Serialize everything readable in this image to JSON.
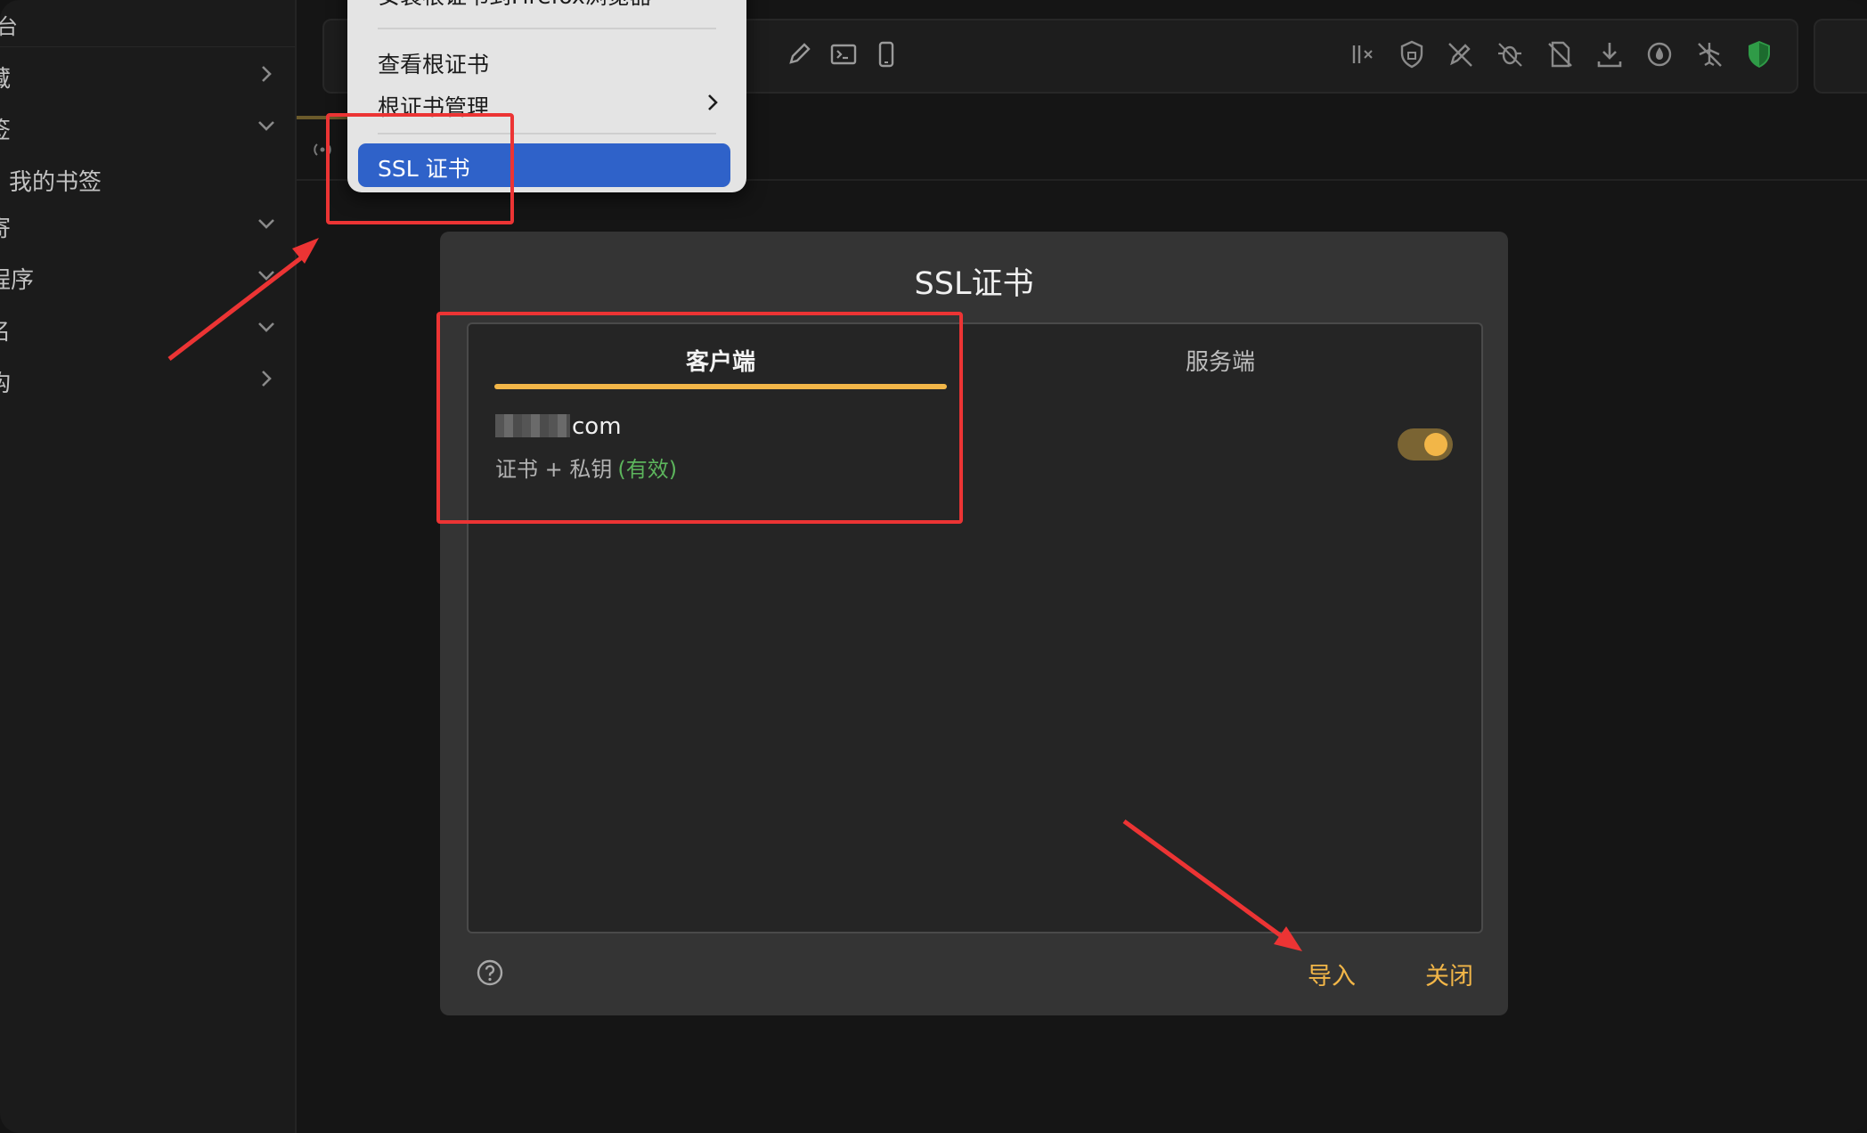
{
  "sidebar": {
    "top_label": "台",
    "items": [
      {
        "label": "藏",
        "chevron": "chevron-right-icon"
      },
      {
        "label": "签",
        "chevron": "chevron-down-icon"
      },
      {
        "label": "我的书签",
        "chevron": ""
      },
      {
        "label": "寄",
        "chevron": "chevron-down-icon"
      },
      {
        "label": "程序",
        "chevron": "chevron-down-icon"
      },
      {
        "label": "名",
        "chevron": "chevron-down-icon"
      },
      {
        "label": "构",
        "chevron": "chevron-right-icon"
      }
    ]
  },
  "toolbar": {
    "icons": [
      "edit-icon",
      "terminal-icon",
      "phone-icon",
      "split-icon",
      "shield-lock-icon",
      "pen-off-icon",
      "bug-off-icon",
      "file-off-icon",
      "download-icon",
      "drop-icon",
      "plane-off-icon",
      "shield-check-icon"
    ]
  },
  "context_menu": {
    "item_firefox": "安装根证书到Firefox浏览器",
    "item_view_root": "查看根证书",
    "item_manage_root": "根证书管理",
    "item_ssl": "SSL 证书"
  },
  "dialog": {
    "title": "SSL证书",
    "tab_client": "客户端",
    "tab_server": "服务端",
    "cert": {
      "domain_suffix": "com",
      "type": "证书 + 私钥",
      "status": "(有效)",
      "enabled": true
    },
    "import_label": "导入",
    "close_label": "关闭"
  },
  "colors": {
    "accent": "#f2b648",
    "selection": "#2f62c9",
    "valid": "#5cb45c",
    "annotation": "#ec3434"
  }
}
